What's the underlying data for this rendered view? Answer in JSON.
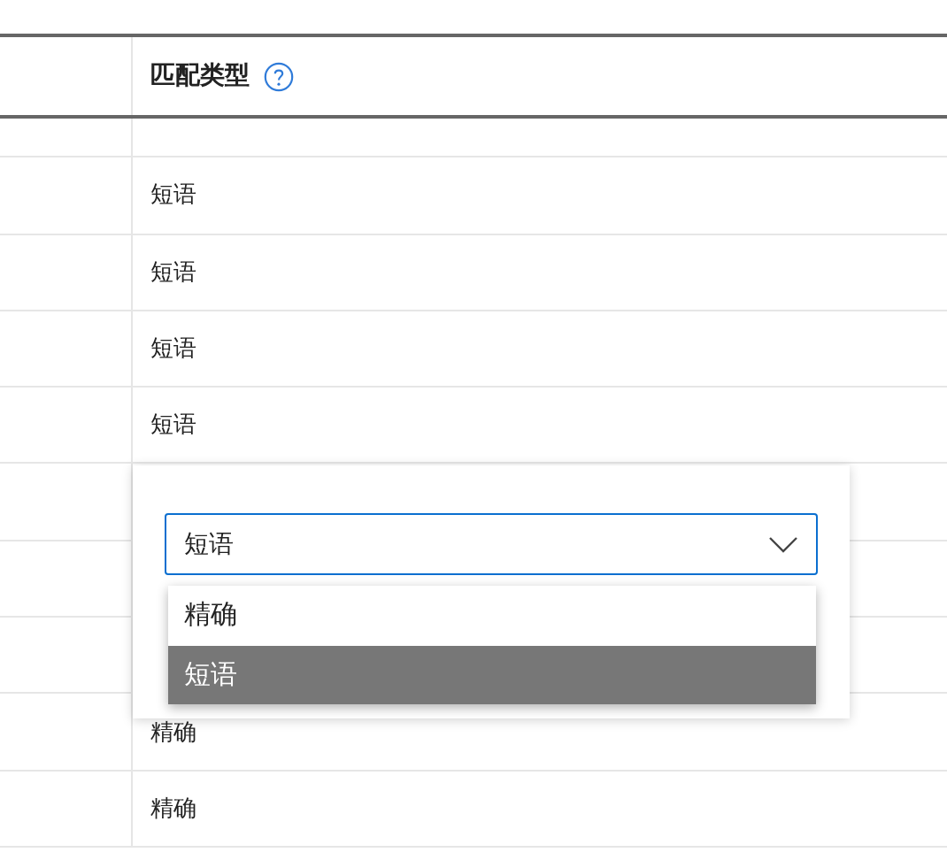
{
  "table": {
    "columns": [
      {
        "label": "匹配类型"
      }
    ],
    "rows": [
      {},
      {
        "match_type": "短语"
      },
      {
        "match_type": "短语"
      },
      {
        "match_type": "短语"
      },
      {
        "match_type": "短语"
      },
      {},
      {},
      {},
      {
        "match_type": "精确"
      },
      {
        "match_type": "精确"
      }
    ]
  },
  "popup": {
    "select": {
      "value": "短语",
      "focused": true
    },
    "options": [
      {
        "label": "精确",
        "selected": false
      },
      {
        "label": "短语",
        "selected": true
      }
    ]
  }
}
